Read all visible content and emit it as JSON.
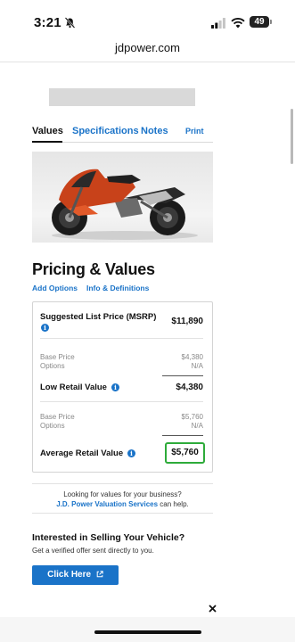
{
  "status_bar": {
    "time": "3:21",
    "battery": "49"
  },
  "browser": {
    "url": "jdpower.com"
  },
  "tabs": [
    {
      "label": "Values",
      "active": true
    },
    {
      "label": "Specifications",
      "active": false
    },
    {
      "label": "Notes",
      "active": false
    },
    {
      "label": "Print",
      "active": false
    }
  ],
  "pricing": {
    "title": "Pricing & Values",
    "links": {
      "add_options": "Add Options",
      "info": "Info & Definitions"
    },
    "msrp_label": "Suggested List Price (MSRP)",
    "msrp_value": "$11,890",
    "low": {
      "base_label": "Base Price",
      "base_value": "$4,380",
      "options_label": "Options",
      "options_value": "N/A",
      "total_label": "Low Retail Value",
      "total_value": "$4,380"
    },
    "average": {
      "base_label": "Base Price",
      "base_value": "$5,760",
      "options_label": "Options",
      "options_value": "N/A",
      "total_label": "Average Retail Value",
      "total_value": "$5,760"
    },
    "info_glyph": "i"
  },
  "business": {
    "line1": "Looking for values for your business?",
    "link": "J.D. Power Valuation Services",
    "line2_suffix": " can help."
  },
  "sell": {
    "title": "Interested in Selling Your Vehicle?",
    "subtitle": "Get a verified offer sent directly to you.",
    "button": "Click Here"
  },
  "colors": {
    "link_blue": "#1a73c8",
    "highlight_green": "#2eab3a",
    "bike_red": "#c8421a"
  }
}
